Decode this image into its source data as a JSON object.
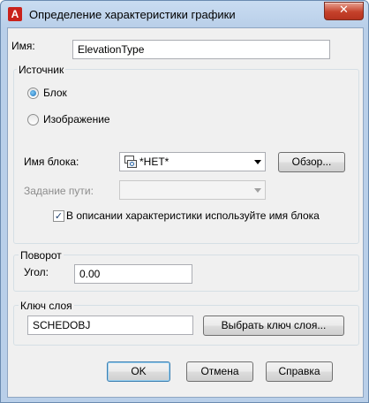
{
  "window": {
    "title": "Определение характеристики графики",
    "app_icon_letter": "A",
    "close_glyph": "✕"
  },
  "name": {
    "label": "Имя:",
    "value": "ElevationType"
  },
  "source": {
    "group_title": "Источник",
    "radio_block_label": "Блок",
    "radio_block_selected": true,
    "radio_image_label": "Изображение",
    "radio_image_selected": false,
    "block_name_label": "Имя блока:",
    "block_name_value": "*НЕТ*",
    "block_icon": "block-definition-icon",
    "browse_label": "Обзор...",
    "path_label": "Задание пути:",
    "path_value": "",
    "use_block_name_checked": true,
    "use_block_name_label": "В описании характеристики используйте имя блока"
  },
  "rotation": {
    "group_title": "Поворот",
    "angle_label": "Угол:",
    "angle_value": "0.00"
  },
  "layer_key": {
    "group_title": "Ключ слоя",
    "value": "SCHEDOBJ",
    "select_label": "Выбрать ключ слоя..."
  },
  "buttons": {
    "ok": "OK",
    "cancel": "Отмена",
    "help": "Справка"
  },
  "colors": {
    "title_bar": "#b9cfe9",
    "close_button": "#c5412b",
    "dialog_bg": "#f0f0f0",
    "default_button_border": "#3c7fb1"
  }
}
